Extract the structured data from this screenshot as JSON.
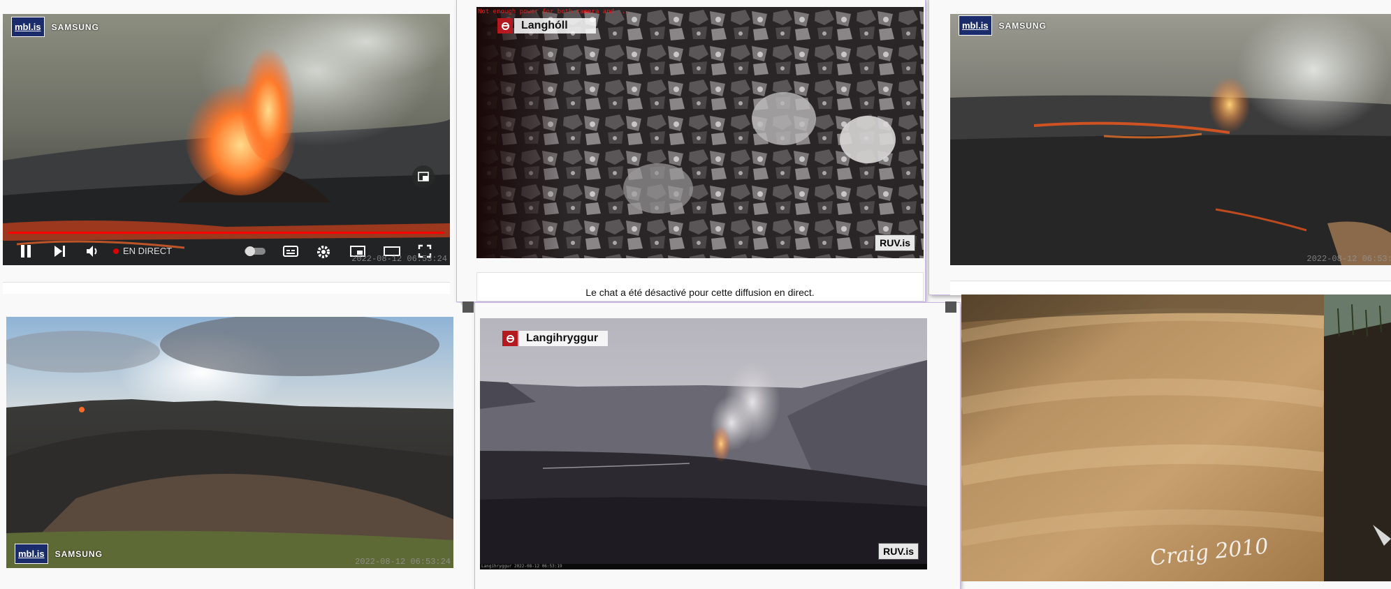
{
  "window1": {
    "brand_logo": "mbl.is",
    "brand_sponsor": "SAMSUNG",
    "live_label": "EN DIRECT",
    "timestamp": "2022-08-12 06:53:24",
    "controls": {
      "pause_icon": "pause-icon",
      "next_icon": "next-icon",
      "volume_icon": "volume-icon",
      "autoplay_icon": "autoplay-toggle-icon",
      "subtitles_icon": "subtitles-icon",
      "settings_icon": "gear-icon",
      "miniplayer_icon": "miniplayer-icon",
      "theater_icon": "theater-icon",
      "fullscreen_icon": "fullscreen-icon"
    }
  },
  "window2": {
    "overlay_warning": "Not enough power for both camera and ...",
    "camera_name": "Langhóll",
    "station_logo": "RUV.is",
    "chat_disabled_message": "Le chat a été désactivé pour cette diffusion en direct."
  },
  "window3": {
    "brand_logo": "mbl.is",
    "brand_sponsor": "SAMSUNG",
    "timestamp": "2022-08-12 06:53:2"
  },
  "window4": {
    "brand_logo": "mbl.is",
    "brand_sponsor": "SAMSUNG",
    "timestamp": "2022-08-12 06:53:24"
  },
  "window5": {
    "camera_name": "Langihryggur",
    "station_logo": "RUV.is",
    "bottom_caption": "Langihryggur 2022-08-12 06:53:19"
  },
  "window6": {
    "signature": "Craig 2010"
  },
  "colors": {
    "page_background": "#f9f9f9",
    "youtube_red": "#ff0000",
    "ruv_red": "#b3191e",
    "mbl_navy": "#1a2c6b",
    "window_selection": "#c9b6e4"
  }
}
